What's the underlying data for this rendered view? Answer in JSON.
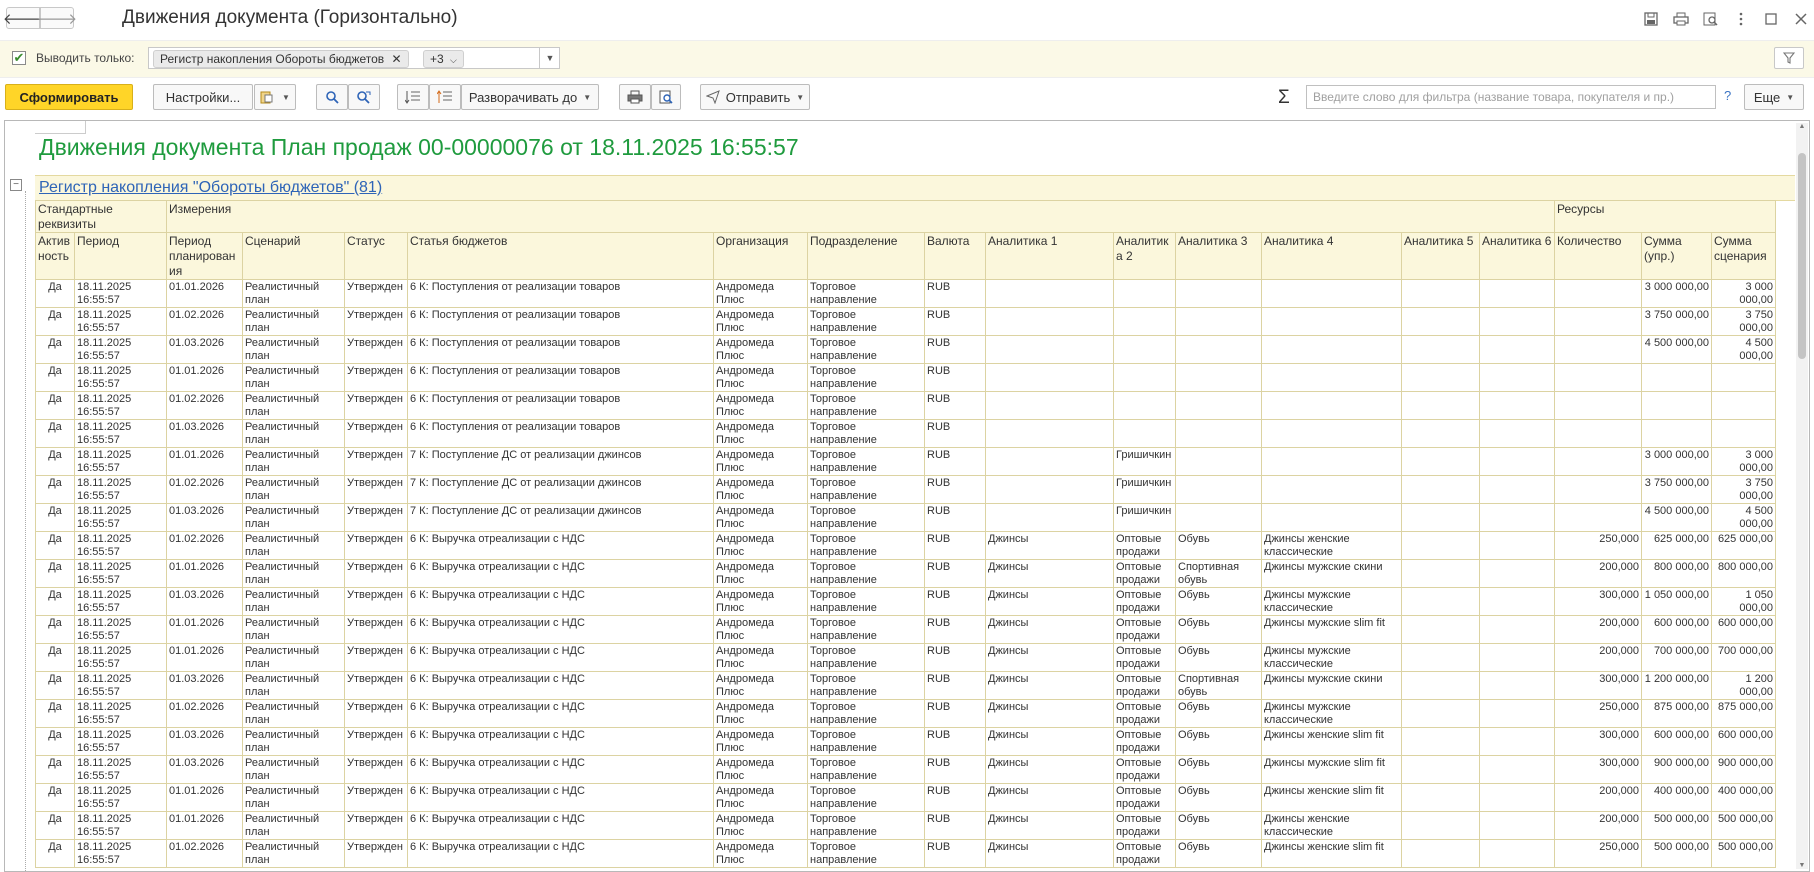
{
  "window": {
    "title": "Движения документа (Горизонтально)",
    "nav_back": "🡐",
    "nav_forward": "🡒",
    "icons": [
      "save-icon",
      "print-icon",
      "preview-icon",
      "more-icon",
      "maximize-icon",
      "close-icon"
    ]
  },
  "filter": {
    "checked": true,
    "label": "Выводить только:",
    "tag1": "Регистр накопления Обороты бюджетов",
    "tag2": "+3"
  },
  "toolbar": {
    "generate": "Сформировать",
    "settings": "Настройки...",
    "expand_to": "Разворачивать до",
    "send": "Отправить",
    "search_placeholder": "Введите слово для фильтра (название товара, покупателя и пр.)",
    "help": "?",
    "more": "Еще"
  },
  "report": {
    "title": "Движения документа План продаж 00-00000076 от 18.11.2025 16:55:57",
    "group_title": "Регистр накопления \"Обороты бюджетов\" (81)",
    "group_headers": {
      "standard": "Стандартные реквизиты",
      "dimensions": "Измерения",
      "resources": "Ресурсы"
    },
    "columns": [
      "Актив ность",
      "Период",
      "Период планирован ия",
      "Сценарий",
      "Статус",
      "Статья бюджетов",
      "Организация",
      "Подразделение",
      "Валюта",
      "Аналитика 1",
      "Аналитик а 2",
      "Аналитика 3",
      "Аналитика 4",
      "Аналитика 5",
      "Аналитика 6",
      "Количество",
      "Сумма (упр.)",
      "Сумма сценария"
    ],
    "rows": [
      [
        "Да",
        "18.11.2025 16:55:57",
        "01.01.2026",
        "Реалистичный план",
        "Утвержден",
        "6 К: Поступления от реализации товаров",
        "Андромеда Плюс",
        "Торговое направление",
        "RUB",
        "",
        "",
        "",
        "",
        "",
        "",
        "",
        "3 000 000,00",
        "3 000 000,00"
      ],
      [
        "Да",
        "18.11.2025 16:55:57",
        "01.02.2026",
        "Реалистичный план",
        "Утвержден",
        "6 К: Поступления от реализации товаров",
        "Андромеда Плюс",
        "Торговое направление",
        "RUB",
        "",
        "",
        "",
        "",
        "",
        "",
        "",
        "3 750 000,00",
        "3 750 000,00"
      ],
      [
        "Да",
        "18.11.2025 16:55:57",
        "01.03.2026",
        "Реалистичный план",
        "Утвержден",
        "6 К: Поступления от реализации товаров",
        "Андромеда Плюс",
        "Торговое направление",
        "RUB",
        "",
        "",
        "",
        "",
        "",
        "",
        "",
        "4 500 000,00",
        "4 500 000,00"
      ],
      [
        "Да",
        "18.11.2025 16:55:57",
        "01.01.2026",
        "Реалистичный план",
        "Утвержден",
        "6 К: Поступления от реализации товаров",
        "Андромеда Плюс",
        "Торговое направление",
        "RUB",
        "",
        "",
        "",
        "",
        "",
        "",
        "",
        "",
        ""
      ],
      [
        "Да",
        "18.11.2025 16:55:57",
        "01.02.2026",
        "Реалистичный план",
        "Утвержден",
        "6 К: Поступления от реализации товаров",
        "Андромеда Плюс",
        "Торговое направление",
        "RUB",
        "",
        "",
        "",
        "",
        "",
        "",
        "",
        "",
        ""
      ],
      [
        "Да",
        "18.11.2025 16:55:57",
        "01.03.2026",
        "Реалистичный план",
        "Утвержден",
        "6 К: Поступления от реализации товаров",
        "Андромеда Плюс",
        "Торговое направление",
        "RUB",
        "",
        "",
        "",
        "",
        "",
        "",
        "",
        "",
        ""
      ],
      [
        "Да",
        "18.11.2025 16:55:57",
        "01.01.2026",
        "Реалистичный план",
        "Утвержден",
        "7 К: Поступление ДС от реализации джинсов",
        "Андромеда Плюс",
        "Торговое направление",
        "RUB",
        "",
        "Гришичкин",
        "",
        "",
        "",
        "",
        "",
        "3 000 000,00",
        "3 000 000,00"
      ],
      [
        "Да",
        "18.11.2025 16:55:57",
        "01.02.2026",
        "Реалистичный план",
        "Утвержден",
        "7 К: Поступление ДС от реализации джинсов",
        "Андромеда Плюс",
        "Торговое направление",
        "RUB",
        "",
        "Гришичкин",
        "",
        "",
        "",
        "",
        "",
        "3 750 000,00",
        "3 750 000,00"
      ],
      [
        "Да",
        "18.11.2025 16:55:57",
        "01.03.2026",
        "Реалистичный план",
        "Утвержден",
        "7 К: Поступление ДС от реализации джинсов",
        "Андромеда Плюс",
        "Торговое направление",
        "RUB",
        "",
        "Гришичкин",
        "",
        "",
        "",
        "",
        "",
        "4 500 000,00",
        "4 500 000,00"
      ],
      [
        "Да",
        "18.11.2025 16:55:57",
        "01.02.2026",
        "Реалистичный план",
        "Утвержден",
        "6 К: Выручка отреализации с НДС",
        "Андромеда Плюс",
        "Торговое направление",
        "RUB",
        "Джинсы",
        "Оптовые продажи",
        "Обувь",
        "Джинсы женские классические",
        "",
        "",
        "250,000",
        "625 000,00",
        "625 000,00"
      ],
      [
        "Да",
        "18.11.2025 16:55:57",
        "01.01.2026",
        "Реалистичный план",
        "Утвержден",
        "6 К: Выручка отреализации с НДС",
        "Андромеда Плюс",
        "Торговое направление",
        "RUB",
        "Джинсы",
        "Оптовые продажи",
        "Спортивная обувь",
        "Джинсы мужские скини",
        "",
        "",
        "200,000",
        "800 000,00",
        "800 000,00"
      ],
      [
        "Да",
        "18.11.2025 16:55:57",
        "01.03.2026",
        "Реалистичный план",
        "Утвержден",
        "6 К: Выручка отреализации с НДС",
        "Андромеда Плюс",
        "Торговое направление",
        "RUB",
        "Джинсы",
        "Оптовые продажи",
        "Обувь",
        "Джинсы мужские классические",
        "",
        "",
        "300,000",
        "1 050 000,00",
        "1 050 000,00"
      ],
      [
        "Да",
        "18.11.2025 16:55:57",
        "01.01.2026",
        "Реалистичный план",
        "Утвержден",
        "6 К: Выручка отреализации с НДС",
        "Андромеда Плюс",
        "Торговое направление",
        "RUB",
        "Джинсы",
        "Оптовые продажи",
        "Обувь",
        "Джинсы мужские slim fit",
        "",
        "",
        "200,000",
        "600 000,00",
        "600 000,00"
      ],
      [
        "Да",
        "18.11.2025 16:55:57",
        "01.01.2026",
        "Реалистичный план",
        "Утвержден",
        "6 К: Выручка отреализации с НДС",
        "Андромеда Плюс",
        "Торговое направление",
        "RUB",
        "Джинсы",
        "Оптовые продажи",
        "Обувь",
        "Джинсы мужские классические",
        "",
        "",
        "200,000",
        "700 000,00",
        "700 000,00"
      ],
      [
        "Да",
        "18.11.2025 16:55:57",
        "01.03.2026",
        "Реалистичный план",
        "Утвержден",
        "6 К: Выручка отреализации с НДС",
        "Андромеда Плюс",
        "Торговое направление",
        "RUB",
        "Джинсы",
        "Оптовые продажи",
        "Спортивная обувь",
        "Джинсы мужские скини",
        "",
        "",
        "300,000",
        "1 200 000,00",
        "1 200 000,00"
      ],
      [
        "Да",
        "18.11.2025 16:55:57",
        "01.02.2026",
        "Реалистичный план",
        "Утвержден",
        "6 К: Выручка отреализации с НДС",
        "Андромеда Плюс",
        "Торговое направление",
        "RUB",
        "Джинсы",
        "Оптовые продажи",
        "Обувь",
        "Джинсы мужские классические",
        "",
        "",
        "250,000",
        "875 000,00",
        "875 000,00"
      ],
      [
        "Да",
        "18.11.2025 16:55:57",
        "01.03.2026",
        "Реалистичный план",
        "Утвержден",
        "6 К: Выручка отреализации с НДС",
        "Андромеда Плюс",
        "Торговое направление",
        "RUB",
        "Джинсы",
        "Оптовые продажи",
        "Обувь",
        "Джинсы женские slim fit",
        "",
        "",
        "300,000",
        "600 000,00",
        "600 000,00"
      ],
      [
        "Да",
        "18.11.2025 16:55:57",
        "01.03.2026",
        "Реалистичный план",
        "Утвержден",
        "6 К: Выручка отреализации с НДС",
        "Андромеда Плюс",
        "Торговое направление",
        "RUB",
        "Джинсы",
        "Оптовые продажи",
        "Обувь",
        "Джинсы мужские slim fit",
        "",
        "",
        "300,000",
        "900 000,00",
        "900 000,00"
      ],
      [
        "Да",
        "18.11.2025 16:55:57",
        "01.01.2026",
        "Реалистичный план",
        "Утвержден",
        "6 К: Выручка отреализации с НДС",
        "Андромеда Плюс",
        "Торговое направление",
        "RUB",
        "Джинсы",
        "Оптовые продажи",
        "Обувь",
        "Джинсы женские slim fit",
        "",
        "",
        "200,000",
        "400 000,00",
        "400 000,00"
      ],
      [
        "Да",
        "18.11.2025 16:55:57",
        "01.01.2026",
        "Реалистичный план",
        "Утвержден",
        "6 К: Выручка отреализации с НДС",
        "Андромеда Плюс",
        "Торговое направление",
        "RUB",
        "Джинсы",
        "Оптовые продажи",
        "Обувь",
        "Джинсы женские классические",
        "",
        "",
        "200,000",
        "500 000,00",
        "500 000,00"
      ],
      [
        "Да",
        "18.11.2025 16:55:57",
        "01.02.2026",
        "Реалистичный план",
        "Утвержден",
        "6 К: Выручка отреализации с НДС",
        "Андромеда Плюс",
        "Торговое направление",
        "RUB",
        "Джинсы",
        "Оптовые продажи",
        "Обувь",
        "Джинсы женские slim fit",
        "",
        "",
        "250,000",
        "500 000,00",
        "500 000,00"
      ]
    ]
  },
  "colors": {
    "accent_yellow": "#ffd528",
    "title_green": "#1f9b3e",
    "link_blue": "#2e64b7",
    "header_bg": "#fbf7dc",
    "grid_line": "#dcd3a2"
  }
}
